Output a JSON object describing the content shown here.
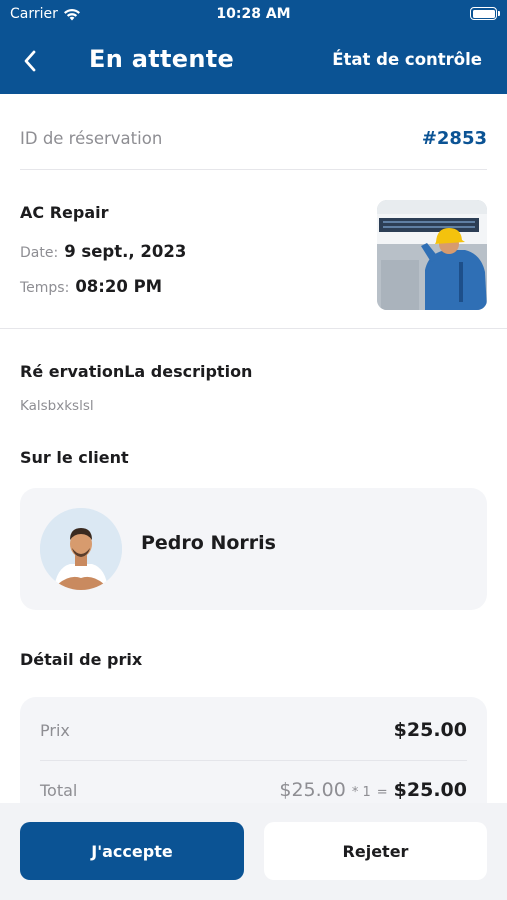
{
  "status_bar": {
    "carrier": "Carrier",
    "time": "10:28 AM"
  },
  "header": {
    "title": "En attente",
    "control_link": "État de contrôle",
    "bg_color": "#0b5394"
  },
  "booking": {
    "id_label": "ID de réservation",
    "id_value": "#2853"
  },
  "service": {
    "name": "AC Repair",
    "date_label": "Date:",
    "date_value": "9 sept., 2023",
    "time_label": "Temps:",
    "time_value": "08:20 PM",
    "image": "ac-repair-technician-photo"
  },
  "description": {
    "title": "Ré ervationLa description",
    "text": "Kalsbxkslsl"
  },
  "client": {
    "section_title": "Sur le client",
    "name": "Pedro Norris",
    "avatar": "client-avatar-photo"
  },
  "price": {
    "section_title": "Détail de prix",
    "price_label": "Prix",
    "price_value": "$25.00",
    "total_label": "Total",
    "total_unit": "$25.00",
    "total_qty": "* 1",
    "total_eq": "=",
    "total_value": "$25.00"
  },
  "actions": {
    "accept": "J'accepte",
    "reject": "Rejeter"
  }
}
